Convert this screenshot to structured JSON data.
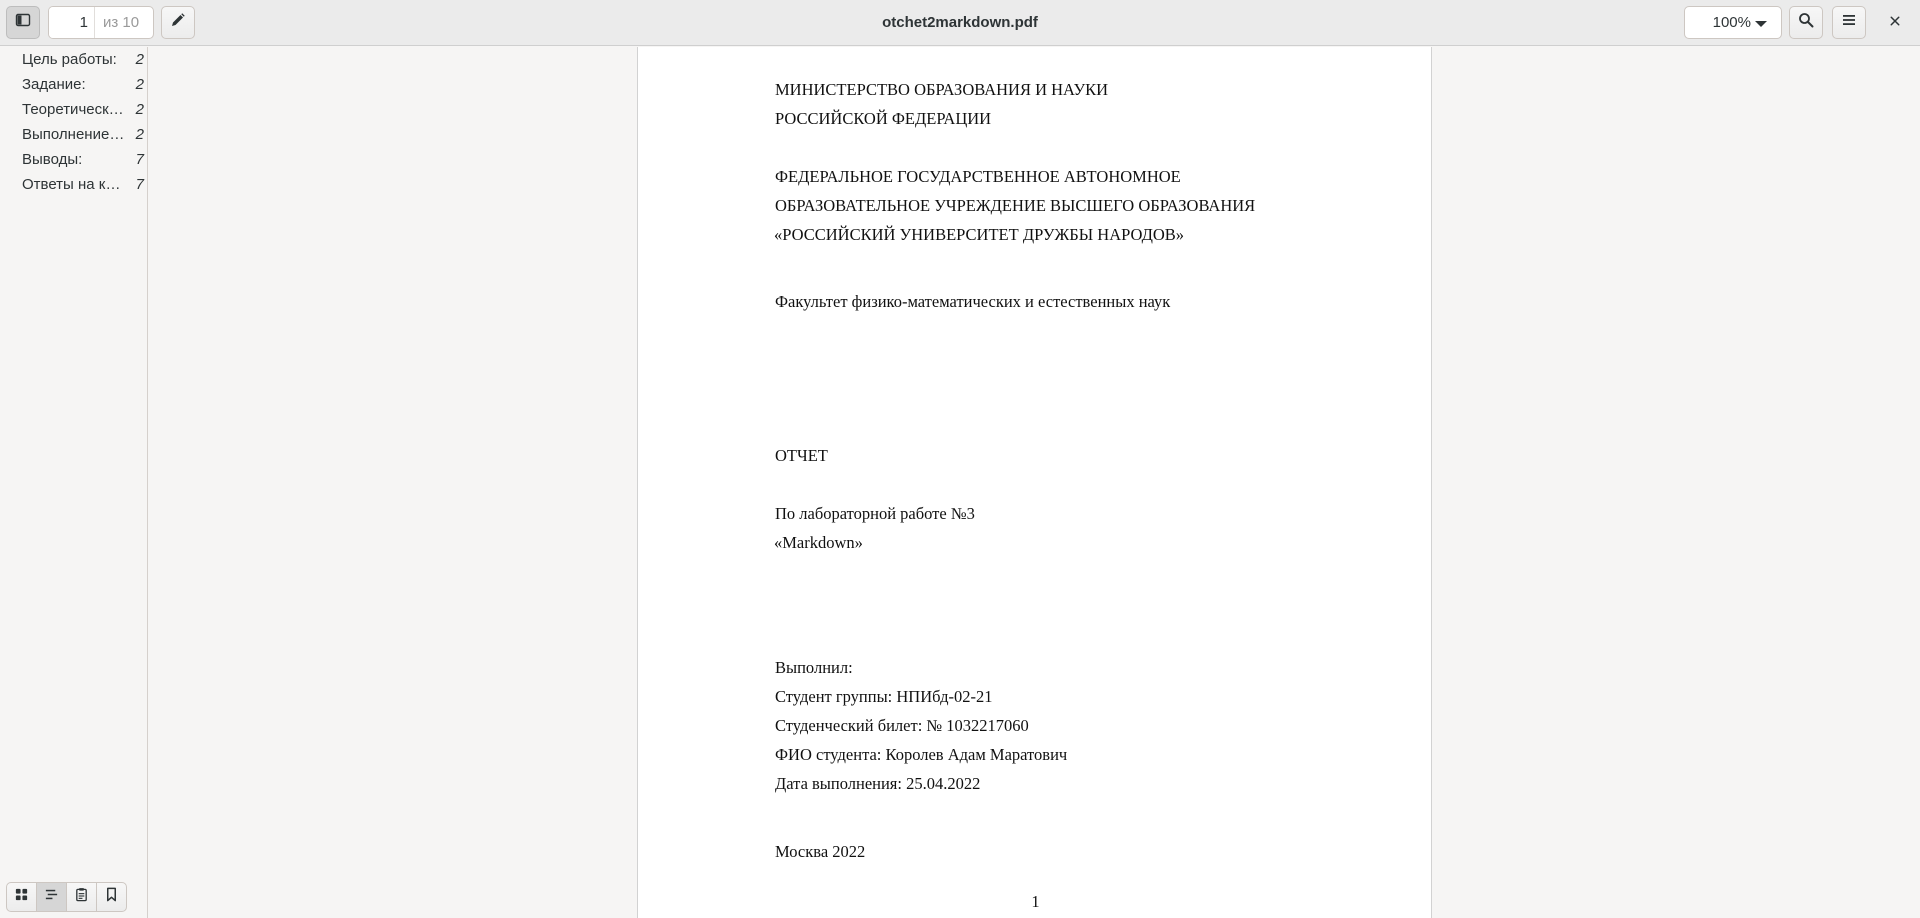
{
  "window": {
    "title": "otchet2markdown.pdf"
  },
  "header": {
    "page_current": "1",
    "page_total": "из 10",
    "zoom": "100%"
  },
  "sidebar": {
    "items": [
      {
        "label": "Цель работы:",
        "page": "2"
      },
      {
        "label": "Задание:",
        "page": "2"
      },
      {
        "label": "Теоретическ…",
        "page": "2"
      },
      {
        "label": "Выполнение …",
        "page": "2"
      },
      {
        "label": "Выводы:",
        "page": "7"
      },
      {
        "label": "Ответы на ко…",
        "page": "7"
      }
    ]
  },
  "document": {
    "lines": [
      "МИНИСТЕРСТВО ОБРАЗОВАНИЯ И НАУКИ",
      "РОССИЙСКОЙ ФЕДЕРАЦИИ",
      "ФЕДЕРАЛЬНОЕ ГОСУДАРСТВЕННОЕ АВТОНОМНОЕ",
      "ОБРАЗОВАТЕЛЬНОЕ УЧРЕЖДЕНИЕ ВЫСШЕГО ОБРАЗОВАНИЯ",
      "«РОССИЙСКИЙ УНИВЕРСИТЕТ ДРУЖБЫ НАРОДОВ»",
      "Факультет физико-математических и естественных наук",
      "ОТЧЕТ",
      "По лабораторной работе №3",
      "«Markdown»",
      "Выполнил:",
      "Студент группы: НПИбд-02-21",
      "Студенческий билет: № 1032217060",
      "ФИО студента: Королев Адам Маратович",
      "Дата выполнения: 25.04.2022",
      "Москва 2022"
    ],
    "page_number": "1"
  },
  "icons": {
    "sidebar_toggle": "sidebar-toggle-icon",
    "annotate": "pencil-icon",
    "search": "search-icon",
    "menu": "hamburger-menu-icon",
    "close": "close-icon",
    "thumbnails": "grid-icon",
    "outline": "outline-icon",
    "annotations": "clipboard-icon",
    "bookmarks": "bookmark-icon"
  }
}
